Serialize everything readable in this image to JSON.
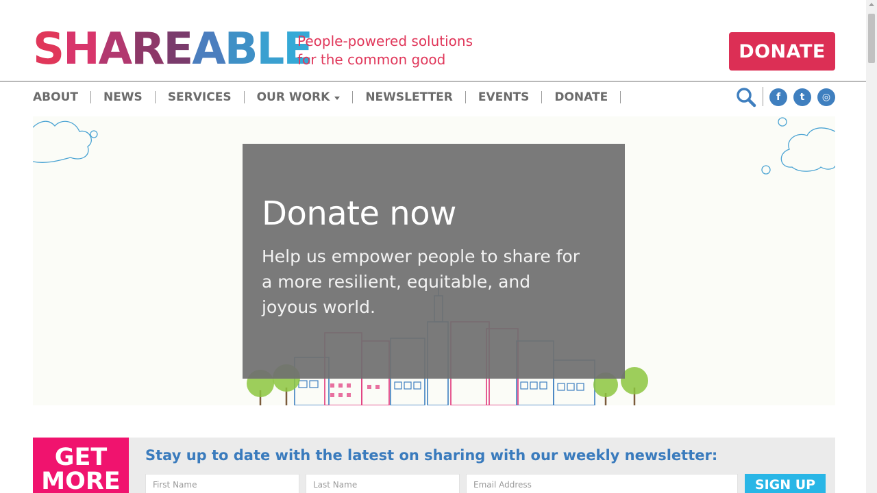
{
  "brand": {
    "logo_letters": [
      "S",
      "H",
      "A",
      "R",
      "E",
      "A",
      "B",
      "L",
      "E"
    ],
    "logo_colors": [
      "#e0375a",
      "#d8356b",
      "#b2386f",
      "#8d3868",
      "#7a3b6c",
      "#4b7ebe",
      "#3f90c6",
      "#3aa0d0",
      "#35a9d6"
    ],
    "tagline_line1": "People-powered solutions",
    "tagline_line2": "for the common good",
    "donate_label": "DONATE"
  },
  "nav": {
    "items": [
      "ABOUT",
      "NEWS",
      "SERVICES",
      "OUR WORK",
      "NEWSLETTER",
      "EVENTS",
      "DONATE"
    ]
  },
  "social": {
    "icons": [
      "facebook-icon",
      "twitter-icon",
      "instagram-icon"
    ],
    "glyphs": [
      "f",
      "t",
      "◎"
    ]
  },
  "hero": {
    "title": "Donate now",
    "text": "Help us empower people to share for a more resilient, equitable, and joyous world."
  },
  "newsletter": {
    "badge_line1": "GET",
    "badge_line2": "MORE",
    "heading": "Stay up to date with the latest on sharing with our weekly newsletter:",
    "first_name_placeholder": "First Name",
    "last_name_placeholder": "Last Name",
    "email_placeholder": "Email Address",
    "signup_label": "SIGN UP"
  },
  "colors": {
    "accent_red": "#dc2f55",
    "accent_blue": "#3a7bbd",
    "accent_pink": "#f0136e",
    "accent_cyan": "#29b6e6"
  }
}
